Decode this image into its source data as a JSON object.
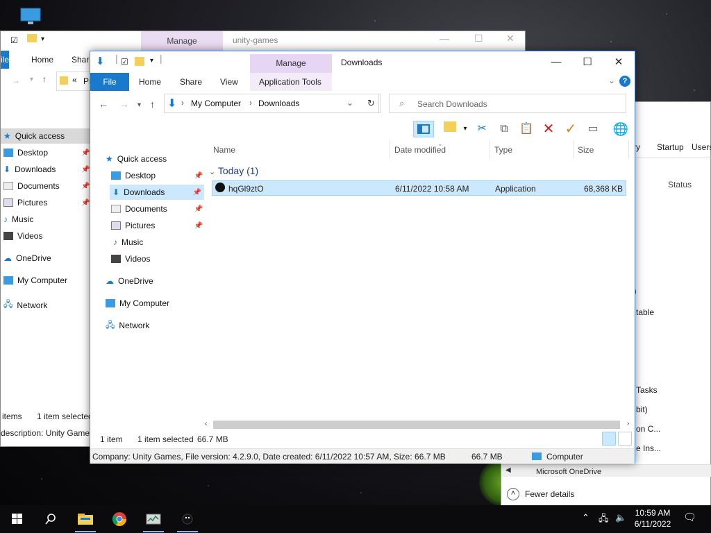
{
  "background_window": {
    "manage_tab": "Manage",
    "title": "unity-games",
    "tabs": [
      "ile",
      "Home",
      "Share"
    ],
    "address_text": "Pr",
    "nav_items": [
      "Quick access",
      "Desktop",
      "Downloads",
      "Documents",
      "Pictures",
      "Music",
      "Videos",
      "OneDrive",
      "My Computer",
      "Network"
    ],
    "status_items": "items",
    "status_selected": "1 item selected",
    "status_description": "description: Unity Games,"
  },
  "task_manager": {
    "tabs": [
      "tory",
      "Startup",
      "Users"
    ],
    "status_header": "Status",
    "fragments": [
      ")",
      "table",
      "Tasks",
      "bit)",
      "on C...",
      "e Ins...",
      "Microsoft OneDrive"
    ],
    "fewer_details": "Fewer details"
  },
  "window": {
    "title": "Downloads",
    "manage_tab": "Manage",
    "ribbon_tabs": {
      "file": "File",
      "home": "Home",
      "share": "Share",
      "view": "View",
      "app_tools": "Application Tools"
    },
    "address": {
      "crumb1": "My Computer",
      "crumb2": "Downloads"
    },
    "search_placeholder": "Search Downloads",
    "nav": {
      "quick_access": "Quick access",
      "desktop": "Desktop",
      "downloads": "Downloads",
      "documents": "Documents",
      "pictures": "Pictures",
      "music": "Music",
      "videos": "Videos",
      "onedrive": "OneDrive",
      "my_computer": "My Computer",
      "network": "Network"
    },
    "columns": {
      "name": "Name",
      "date_modified": "Date modified",
      "type": "Type",
      "size": "Size"
    },
    "group_label": "Today (1)",
    "files": [
      {
        "name": "hqGl9ztO",
        "date_modified": "6/11/2022 10:58 AM",
        "type": "Application",
        "size": "68,368 KB"
      }
    ],
    "status": {
      "count": "1 item",
      "selected": "1 item selected",
      "size": "66.7 MB"
    },
    "details_bar": {
      "description": "Company: Unity Games, File version: 4.2.9.0, Date created: 6/11/2022 10:57 AM, Size: 66.7 MB",
      "size": "66.7 MB",
      "location": "Computer"
    }
  },
  "taskbar": {
    "time": "10:59 AM",
    "date": "6/11/2022"
  }
}
